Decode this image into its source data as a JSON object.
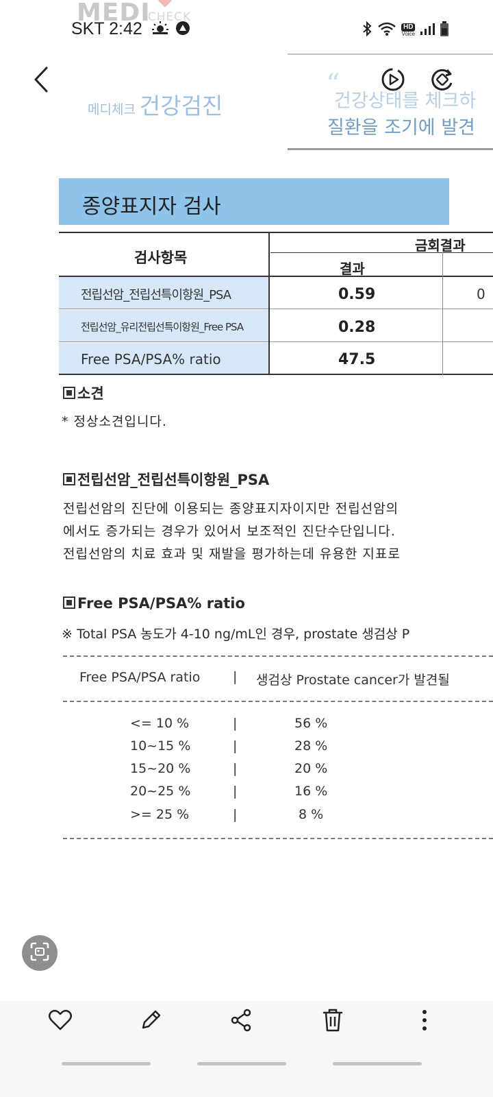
{
  "status_bar": {
    "carrier_time": "SKT 2:42",
    "icons": [
      "weather-icon",
      "alert-icon",
      "bluetooth-icon",
      "wifi-icon",
      "hd-voice-icon",
      "signal-icon",
      "battery-icon"
    ],
    "hd_voice_label": "HD",
    "voice_label": "Voice"
  },
  "toolbar": {
    "back_icon": "chevron-left-icon",
    "play_icon": "motion-play-icon",
    "rotate_icon": "rotate-icon"
  },
  "document": {
    "logo_text": "MEDI",
    "logo_check": "CHECK",
    "brand_small": "메디체크",
    "brand_big": "건강검진",
    "quote_mark": "“",
    "quote_line1": "건강상태를 체크하",
    "quote_line2": "질환을 조기에 발견",
    "section_title": "종양표지자 검사",
    "table": {
      "header_item": "검사항목",
      "header_round": "금회결과",
      "header_result": "결과",
      "rows": [
        {
          "name": "전립선암_전립선특이항원_PSA",
          "value": "0.59",
          "extra": "0"
        },
        {
          "name": "전립선암_유리전립선특이항원_Free PSA",
          "value": "0.28",
          "extra": ""
        },
        {
          "name": "Free PSA/PSA% ratio",
          "value": "47.5",
          "extra": ""
        }
      ]
    },
    "opinion_heading": "소견",
    "opinion_text": "* 정상소견입니다.",
    "psa_heading": "전립선암_전립선특이항원_PSA",
    "psa_lines": [
      "전립선암의 진단에 이용되는 종양표지자이지만 전립선암의",
      "에서도 증가되는 경우가 있어서 보조적인 진단수단입니다.",
      "전립선암의 치료 효과 및 재발을 평가하는데 유용한 지표로"
    ],
    "ratio_heading": "Free PSA/PSA% ratio",
    "ratio_note": "※ Total PSA 농도가 4-10 ng/mL인 경우, prostate 생검상 P",
    "ratio_table_header_left": "Free PSA/PSA ratio",
    "ratio_table_header_sep": "|",
    "ratio_table_header_right": "생검상 Prostate cancer가 발견될",
    "ratio_rows": [
      {
        "range": "<= 10 %",
        "sep": "|",
        "pct": "56 %"
      },
      {
        "range": "10~15 %",
        "sep": "|",
        "pct": "28 %"
      },
      {
        "range": "15~20 %",
        "sep": "|",
        "pct": "20 %"
      },
      {
        "range": "20~25 %",
        "sep": "|",
        "pct": "16 %"
      },
      {
        "range": ">= 25 %",
        "sep": "|",
        "pct": "8 %"
      }
    ]
  },
  "bottom_actions": {
    "icons": [
      "heart-icon",
      "edit-icon",
      "share-icon",
      "delete-icon",
      "more-icon"
    ]
  },
  "colors": {
    "section_band": "#8ec3ea",
    "table_name_bg": "#d6e8f7",
    "bottom_bar": "#f7f7f7",
    "ocr_button": "#8e8e8e"
  }
}
